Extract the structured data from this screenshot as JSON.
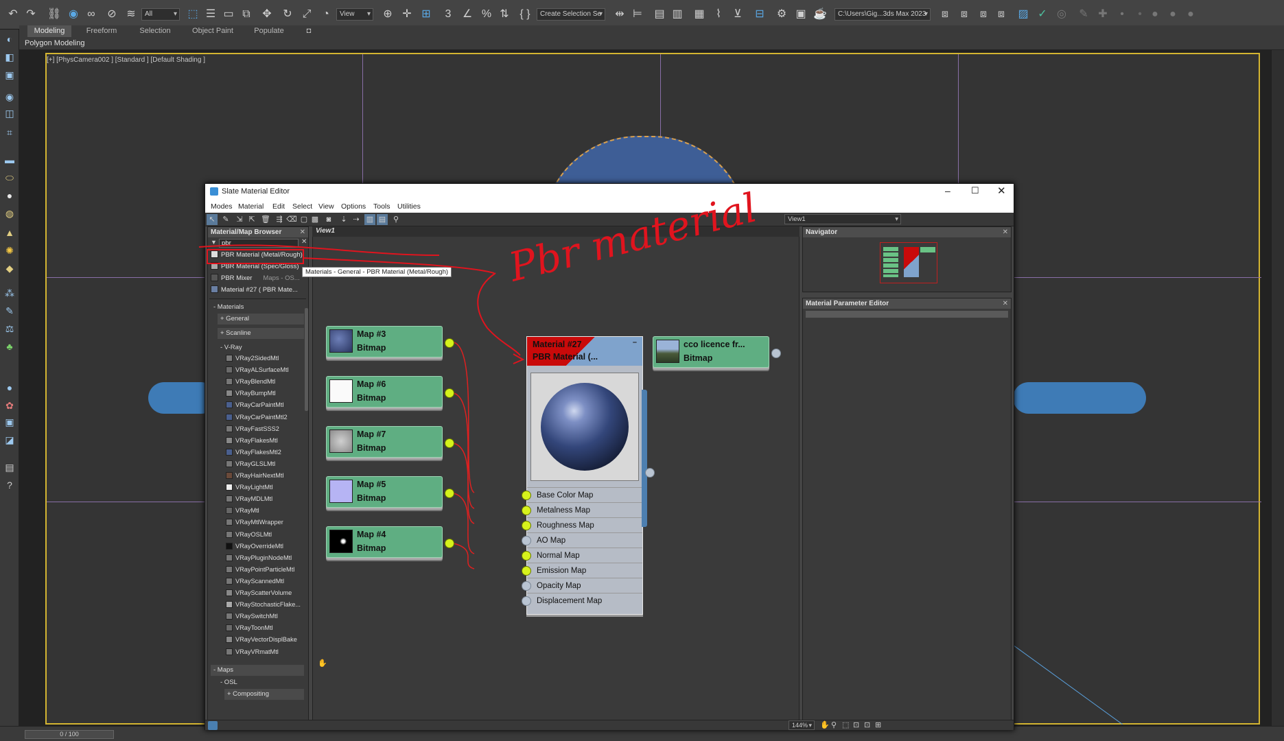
{
  "toolbar": {
    "selection_filter": "All",
    "ref_coord": "View",
    "named_selection": "Create Selection Se",
    "project_path": "C:\\Users\\Gig...3ds Max 2023"
  },
  "ribbon": {
    "tabs": [
      "Modeling",
      "Freeform",
      "Selection",
      "Object Paint",
      "Populate"
    ],
    "sub_label": "Polygon Modeling"
  },
  "viewport": {
    "label": "[+] [PhysCamera002 ] [Standard ] [Default Shading ]"
  },
  "timeslider": {
    "value": "0 / 100"
  },
  "slate": {
    "title": "Slate Material Editor",
    "menus": [
      "Modes",
      "Material",
      "Edit",
      "Select",
      "View",
      "Options",
      "Tools",
      "Utilities"
    ],
    "view_dropdown": "View1",
    "zoom": "144%",
    "browser": {
      "title": "Material/Map Browser",
      "search_value": "pbr",
      "results": [
        {
          "label": "PBR Material (Metal/Rough)",
          "extra": ""
        },
        {
          "label": "PBR Material (Spec/Gloss)",
          "extra": ""
        },
        {
          "label": "PBR Mixer",
          "extra": "Maps - OS..."
        },
        {
          "label": "Material #27  ( PBR Mate...",
          "extra": ""
        }
      ],
      "tooltip": "Materials - General - PBR Material (Metal/Rough)",
      "sections": {
        "materials": "- Materials",
        "general": "+ General",
        "scanline": "+ Scanline",
        "vray": "- V-Ray",
        "maps": "- Maps",
        "osl": "- OSL",
        "compositing": "+ Compositing"
      },
      "vray_items": [
        "VRay2SidedMtl",
        "VRayALSurfaceMtl",
        "VRayBlendMtl",
        "VRayBumpMtl",
        "VRayCarPaintMtl",
        "VRayCarPaintMtl2",
        "VRayFastSSS2",
        "VRayFlakesMtl",
        "VRayFlakesMtl2",
        "VRayGLSLMtl",
        "VRayHairNextMtl",
        "VRayLightMtl",
        "VRayMDLMtl",
        "VRayMtl",
        "VRayMtlWrapper",
        "VRayOSLMtl",
        "VRayOverrideMtl",
        "VRayPluginNodeMtl",
        "VRayPointParticleMtl",
        "VRayScannedMtl",
        "VRayScatterVolume",
        "VRayStochasticFlake...",
        "VRaySwitchMtl",
        "VRayToonMtl",
        "VRayVectorDisplBake",
        "VRayVRmatMtl"
      ]
    },
    "view_tab": "View1",
    "maps": [
      {
        "name": "Map #3",
        "type": "Bitmap"
      },
      {
        "name": "Map #6",
        "type": "Bitmap"
      },
      {
        "name": "Map #7",
        "type": "Bitmap"
      },
      {
        "name": "Map #5",
        "type": "Bitmap"
      },
      {
        "name": "Map #4",
        "type": "Bitmap"
      }
    ],
    "material": {
      "name": "Material #27",
      "type": "PBR Material (...",
      "slots": [
        "Base Color Map",
        "Metalness Map",
        "Roughness Map",
        "AO Map",
        "Normal Map",
        "Emission Map",
        "Opacity Map",
        "Displacement Map"
      ]
    },
    "extra_map": {
      "name": "cco licence fr...",
      "type": "Bitmap"
    },
    "navigator_title": "Navigator",
    "param_editor_title": "Material Parameter Editor"
  },
  "annotation": {
    "text": "Pbr material",
    "color": "#e0141e"
  }
}
